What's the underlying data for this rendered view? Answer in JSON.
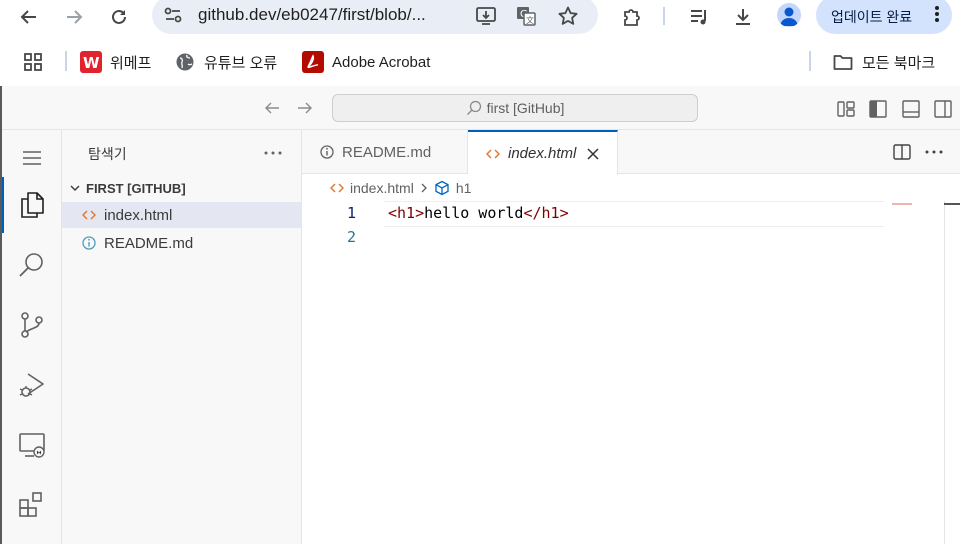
{
  "browser": {
    "url": "github.dev/eb0247/first/blob/...",
    "update_label": "업데이트 완료"
  },
  "bookmarks": [
    {
      "label": "위메프",
      "icon": "wemakeprice-logo-icon"
    },
    {
      "label": "유튜브 오류",
      "icon": "globe-icon"
    },
    {
      "label": "Adobe Acrobat",
      "icon": "adobe-acrobat-icon"
    }
  ],
  "bookmarks_folder": "모든 북마크",
  "vscode": {
    "command_center": "first [GitHub]",
    "explorer_title": "탐색기",
    "section_title": "FIRST [GITHUB]",
    "files": [
      {
        "name": "index.html",
        "icon": "html-file-icon",
        "selected": true
      },
      {
        "name": "README.md",
        "icon": "info-file-icon",
        "selected": false
      }
    ],
    "tabs": [
      {
        "label": "README.md",
        "active": false
      },
      {
        "label": "index.html",
        "active": true
      }
    ],
    "breadcrumb": {
      "file": "index.html",
      "symbol": "h1"
    },
    "code_lines": [
      {
        "number": "1",
        "open_tag": "<h1>",
        "text": "hello world",
        "close_tag": "</h1>"
      },
      {
        "number": "2",
        "open_tag": "",
        "text": "",
        "close_tag": ""
      }
    ]
  },
  "colors": {
    "accent": "#005fb8",
    "omnibox": "#e9eef6",
    "update_button": "#d3e3fd",
    "html_tag": "#800000"
  }
}
